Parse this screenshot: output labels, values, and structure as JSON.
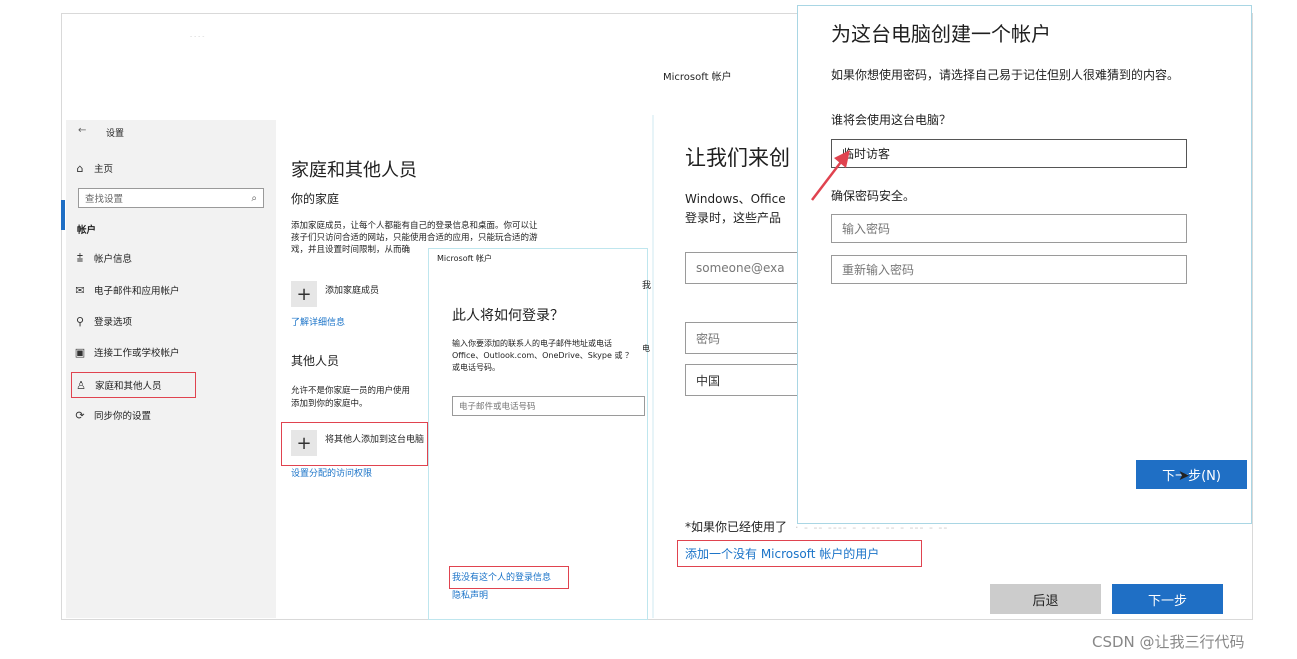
{
  "settings": {
    "back_glyph": "←",
    "title": "设置",
    "home": "主页",
    "search_placeholder": "查找设置",
    "section": "帐户",
    "nav": [
      "帐户信息",
      "电子邮件和应用帐户",
      "登录选项",
      "连接工作或学校帐户",
      "家庭和其他人员",
      "同步你的设置"
    ],
    "page_title": "家庭和其他人员",
    "family_heading": "你的家庭",
    "family_desc": [
      "添加家庭成员，让每个人都能有自己的登录信息和桌面。你可以让",
      "孩子们只访问合适的网站，只能使用合适的应用，只能玩合适的游",
      "戏，并且设置时间限制，从而确"
    ],
    "add_family": "添加家庭成员",
    "learn_more": "了解详细信息",
    "others_heading": "其他人员",
    "others_desc": [
      "允许不是你家庭一员的用户使用",
      "添加到你的家庭中。"
    ],
    "add_other": "将其他人添加到这台电脑",
    "assigned_access": "设置分配的访问权限"
  },
  "dialog_signin": {
    "header": "Microsoft 帐户",
    "side_char": "我",
    "title": "此人将如何登录？",
    "desc": [
      "输入你要添加的联系人的电子邮件地址或电话",
      "Office、Outlook.com、OneDrive、Skype 或 ？",
      "或电话号码。"
    ],
    "side_char2": "电",
    "email_placeholder": "电子邮件或电话号码",
    "no_signin_link": "我没有这个人的登录信息",
    "privacy": "隐私声明"
  },
  "dialog_create": {
    "header": "Microsoft 帐户",
    "title": "让我们来创",
    "desc": [
      "Windows、Office",
      "登录时，这些产品"
    ],
    "email_placeholder": "someone@exa",
    "password_placeholder": "密码",
    "country": "中国",
    "footnote": "*如果你已经使用了",
    "no_account_link": "添加一个没有 Microsoft 帐户的用户",
    "back_button": "后退",
    "next_button": "下一步"
  },
  "dialog_local": {
    "title": "为这台电脑创建一个帐户",
    "desc": "如果你想使用密码，请选择自己易于记住但别人很难猜到的内容。",
    "who_label": "谁将会使用这台电脑？",
    "username_value": "临时访客",
    "password_label": "确保密码安全。",
    "password_placeholder": "输入密码",
    "repeat_placeholder": "重新输入密码",
    "next_button": "下一步(N)"
  },
  "watermark": "CSDN @让我三行代码",
  "colors": {
    "accent": "#1f6fc5",
    "highlight": "#e0434f",
    "link": "#1a73c8"
  }
}
